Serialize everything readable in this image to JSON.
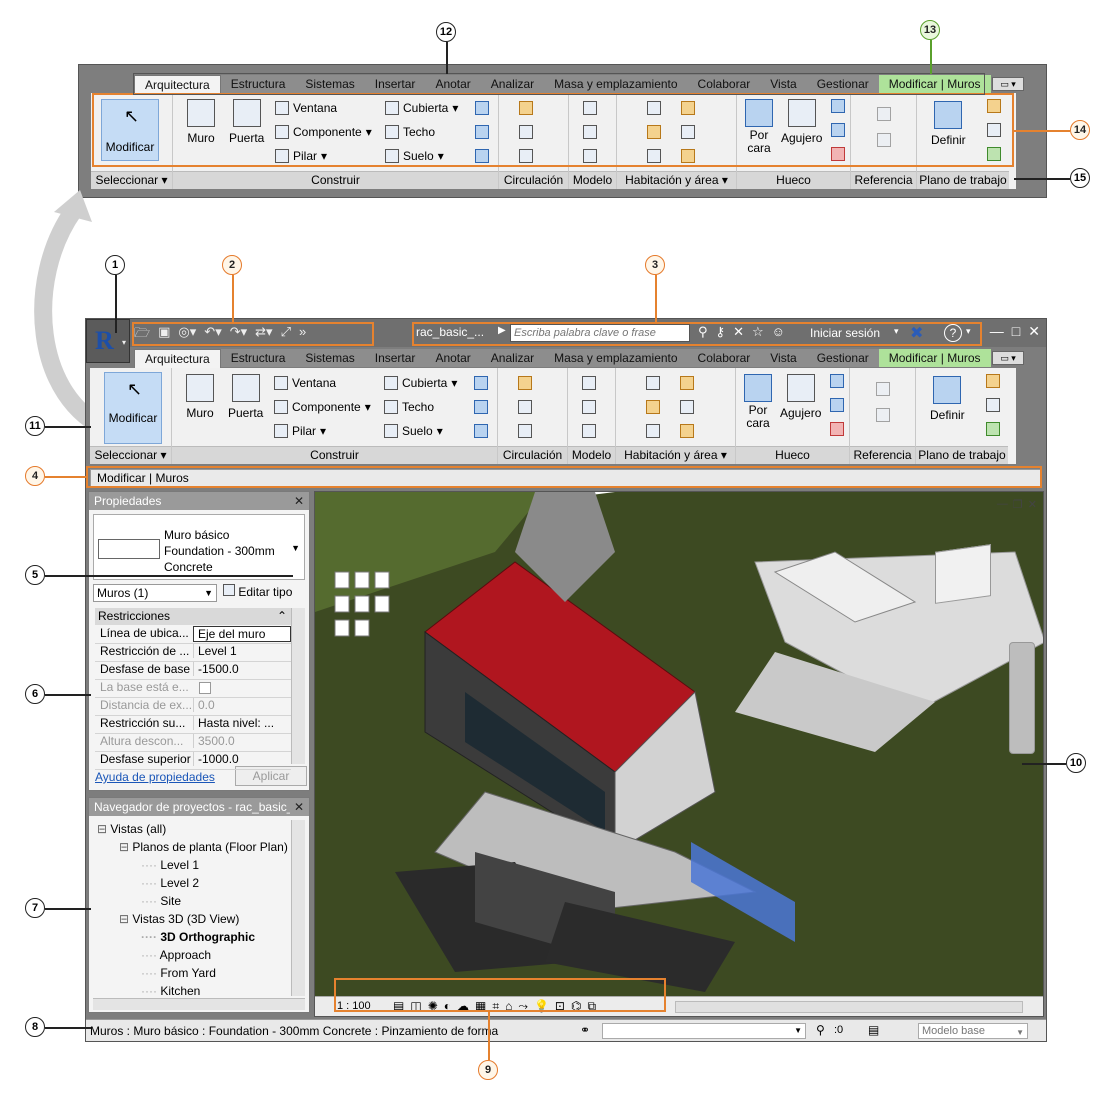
{
  "tabs": [
    "Arquitectura",
    "Estructura",
    "Sistemas",
    "Insertar",
    "Anotar",
    "Analizar",
    "Masa y emplazamiento",
    "Colaborar",
    "Vista",
    "Gestionar",
    "Modificar | Muros"
  ],
  "ribbon": {
    "modificar": "Modificar",
    "muro": "Muro",
    "puerta": "Puerta",
    "ventana": "Ventana",
    "componente": "Componente",
    "pilar": "Pilar",
    "cubierta": "Cubierta",
    "techo": "Techo",
    "suelo": "Suelo",
    "por": "Por",
    "cara": "cara",
    "agujero": "Agujero",
    "definir": "Definir",
    "panels": [
      "Seleccionar",
      "Construir",
      "Circulación",
      "Modelo",
      "Habitación y área",
      "Hueco",
      "Referencia",
      "Plano de trabajo"
    ]
  },
  "qat": {
    "filename": "rac_basic_...",
    "search_placeholder": "Escriba palabra clave o frase",
    "login": "Iniciar sesión"
  },
  "options_bar": "Modificar | Muros",
  "properties": {
    "title": "Propiedades",
    "type_line1": "Muro básico",
    "type_line2": "Foundation - 300mm",
    "type_line3": "Concrete",
    "filter": "Muros (1)",
    "edit_type": "Editar tipo",
    "section": "Restricciones",
    "rows": [
      {
        "k": "Línea de ubica...",
        "v": "Eje del muro",
        "dim": false
      },
      {
        "k": "Restricción de ...",
        "v": "Level 1",
        "dim": false
      },
      {
        "k": "Desfase de base",
        "v": "-1500.0",
        "dim": false
      },
      {
        "k": "La base está e...",
        "v": "",
        "dim": true
      },
      {
        "k": "Distancia de ex...",
        "v": "0.0",
        "dim": true
      },
      {
        "k": "Restricción su...",
        "v": "Hasta nivel: ...",
        "dim": false
      },
      {
        "k": "Altura descon...",
        "v": "3500.0",
        "dim": true
      },
      {
        "k": "Desfase superior",
        "v": "-1000.0",
        "dim": false
      }
    ],
    "help": "Ayuda de propiedades",
    "apply": "Aplicar"
  },
  "browser": {
    "title": "Navegador de proyectos - rac_basic_...",
    "items": [
      {
        "t": "Vistas (all)",
        "lvl": 0,
        "bold": false
      },
      {
        "t": "Planos de planta (Floor Plan)",
        "lvl": 1,
        "bold": false
      },
      {
        "t": "Level 1",
        "lvl": 2,
        "bold": false
      },
      {
        "t": "Level 2",
        "lvl": 2,
        "bold": false
      },
      {
        "t": "Site",
        "lvl": 2,
        "bold": false
      },
      {
        "t": "Vistas 3D (3D View)",
        "lvl": 1,
        "bold": false
      },
      {
        "t": "3D Orthographic",
        "lvl": 2,
        "bold": true
      },
      {
        "t": "Approach",
        "lvl": 2,
        "bold": false
      },
      {
        "t": "From Yard",
        "lvl": 2,
        "bold": false
      },
      {
        "t": "Kitchen",
        "lvl": 2,
        "bold": false
      }
    ]
  },
  "viewbar": {
    "scale": "1 : 100"
  },
  "status": {
    "text": "Muros : Muro básico : Foundation - 300mm Concrete : Pinzamiento de forma",
    "zero": ":0",
    "model": "Modelo base"
  },
  "callouts": [
    "1",
    "2",
    "3",
    "4",
    "5",
    "6",
    "7",
    "8",
    "9",
    "10",
    "11",
    "12",
    "13",
    "14",
    "15"
  ],
  "colors": {
    "accent": "#e5822f",
    "context_tab": "#aee29a",
    "roof": "#b0161f",
    "ground": "#3d4a22"
  }
}
